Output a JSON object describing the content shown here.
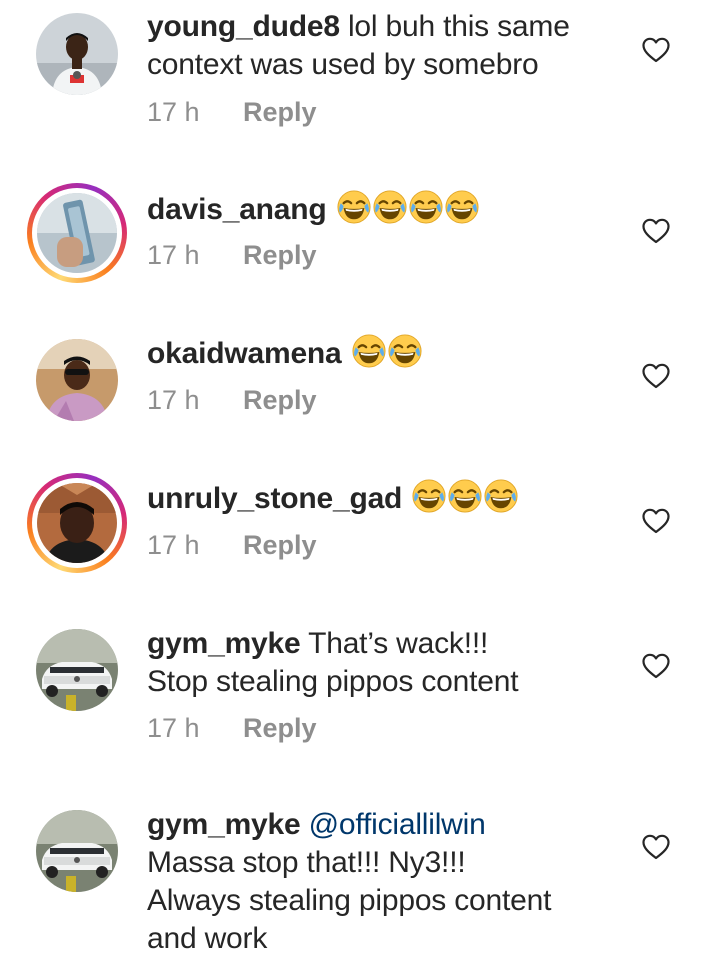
{
  "comments": [
    {
      "username": "young_dude8",
      "mention": "",
      "text_line1": " lol buh this same",
      "text_line2": "context was used by somebro",
      "text_line3": "",
      "text_line4": "",
      "emoji_count": 0,
      "time": "17 h",
      "reply_label": "Reply",
      "has_story_ring": false
    },
    {
      "username": "davis_anang",
      "mention": "",
      "text_line1": "",
      "emoji_count": 4,
      "emoji_name": "face-with-tears-of-joy",
      "time": "17 h",
      "reply_label": "Reply",
      "has_story_ring": true
    },
    {
      "username": "okaidwamena",
      "mention": "",
      "text_line1": "",
      "emoji_count": 2,
      "emoji_name": "face-with-tears-of-joy",
      "time": "17 h",
      "reply_label": "Reply",
      "has_story_ring": false
    },
    {
      "username": "unruly_stone_gad",
      "mention": "",
      "text_line1": "",
      "emoji_count": 3,
      "emoji_name": "face-with-tears-of-joy",
      "time": "17 h",
      "reply_label": "Reply",
      "has_story_ring": true
    },
    {
      "username": "gym_myke",
      "mention": "",
      "text_line1": " That’s wack!!!",
      "text_line2": "Stop stealing pippos content",
      "time": "17 h",
      "reply_label": "Reply",
      "has_story_ring": false
    },
    {
      "username": "gym_myke",
      "mention": " @officiallilwin",
      "text_line2": "Massa stop that!!! Ny3!!!",
      "text_line3": "Always stealing pippos content",
      "text_line4": "and work",
      "has_story_ring": false
    }
  ],
  "icons": {
    "like": "heart-outline-icon",
    "emoji": "face-with-tears-of-joy"
  },
  "colors": {
    "text": "#262626",
    "secondary": "#8e8e8e",
    "mention": "#00376b",
    "story_ring": [
      "#feda75",
      "#fa7e1e",
      "#d62976",
      "#962fbf"
    ]
  }
}
